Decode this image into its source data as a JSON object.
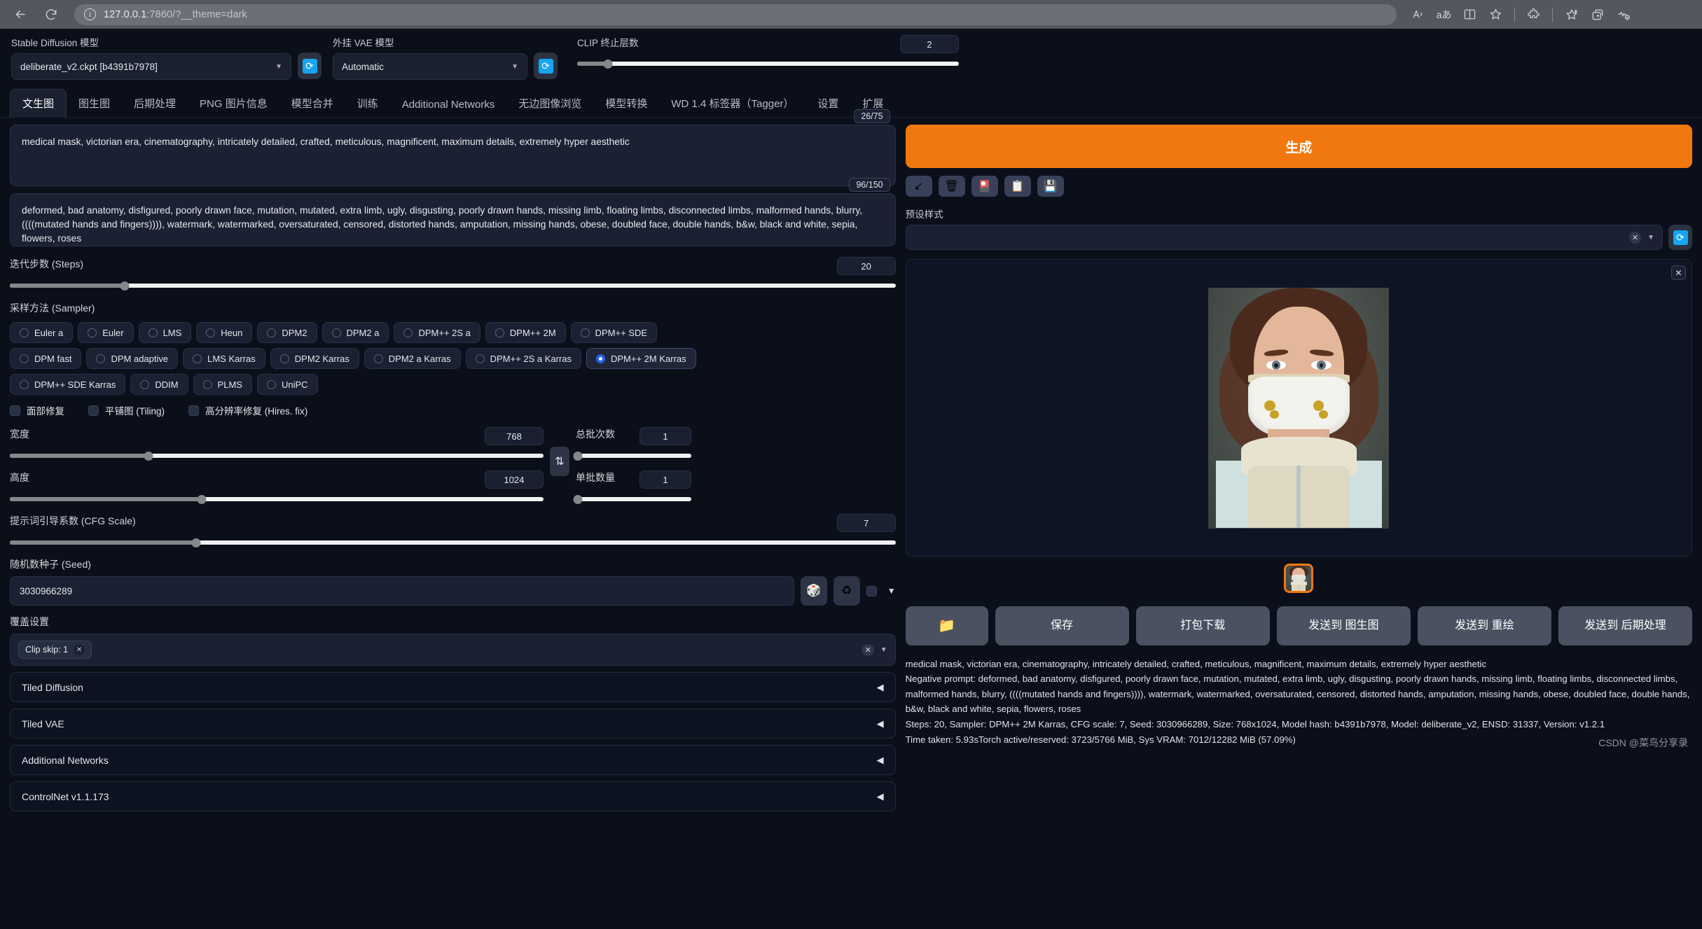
{
  "browser": {
    "back_icon": "back-arrow-icon",
    "reload_icon": "reload-icon",
    "url_host": "127.0.0.1",
    "url_rest": ":7860/?__theme=dark",
    "icons": [
      "read-aloud-icon",
      "translate-icon",
      "split-screen-icon",
      "favorite-star-icon",
      "extensions-icon",
      "collections-icon",
      "add-to-favorites-icon",
      "browser-essentials-icon"
    ]
  },
  "topbar": {
    "sd_model_label": "Stable Diffusion 模型",
    "sd_model_value": "deliberate_v2.ckpt [b4391b7978]",
    "vae_label": "外挂 VAE 模型",
    "vae_value": "Automatic",
    "clip_label": "CLIP 终止层数",
    "clip_value": "2",
    "clip_percent": 8,
    "refresh_icon": "refresh-icon"
  },
  "tabs": [
    {
      "label": "文生图",
      "active": true
    },
    {
      "label": "图生图",
      "active": false
    },
    {
      "label": "后期处理",
      "active": false
    },
    {
      "label": "PNG 图片信息",
      "active": false
    },
    {
      "label": "模型合并",
      "active": false
    },
    {
      "label": "训练",
      "active": false
    },
    {
      "label": "Additional Networks",
      "active": false
    },
    {
      "label": "无边图像浏览",
      "active": false
    },
    {
      "label": "模型转换",
      "active": false
    },
    {
      "label": "WD 1.4 标签器（Tagger）",
      "active": false
    },
    {
      "label": "设置",
      "active": false
    },
    {
      "label": "扩展",
      "active": false
    }
  ],
  "prompts": {
    "positive": "medical mask, victorian era, cinematography, intricately detailed, crafted, meticulous, magnificent, maximum details, extremely hyper aesthetic",
    "positive_counter": "26/75",
    "negative": "deformed, bad anatomy, disfigured, poorly drawn face, mutation, mutated, extra limb, ugly, disgusting, poorly drawn hands, missing limb, floating limbs, disconnected limbs, malformed hands, blurry, ((((mutated hands and fingers)))), watermark, watermarked, oversaturated, censored, distorted hands, amputation, missing hands, obese, doubled face, double hands, b&w, black and white, sepia, flowers, roses",
    "negative_counter": "96/150"
  },
  "generate": {
    "button_label": "生成",
    "accent_color": "#f0780f",
    "tools": [
      {
        "name": "arrow-down-left-icon",
        "glyph": "↙"
      },
      {
        "name": "trash-icon",
        "glyph": "🗑"
      },
      {
        "name": "palette-icon",
        "glyph": "🎴"
      },
      {
        "name": "clipboard-icon",
        "glyph": "📋"
      },
      {
        "name": "save-style-icon",
        "glyph": "💾"
      }
    ],
    "styles_label": "预设样式",
    "styles_value": "",
    "styles_clear_icon": "clear-x-icon",
    "styles_refresh_icon": "refresh-icon"
  },
  "settings": {
    "steps_label": "迭代步数 (Steps)",
    "steps_value": "20",
    "steps_percent": 13,
    "sampler_label": "采样方法 (Sampler)",
    "samplers": [
      [
        "Euler a",
        "Euler",
        "LMS",
        "Heun",
        "DPM2",
        "DPM2 a",
        "DPM++ 2S a",
        "DPM++ 2M",
        "DPM++ SDE"
      ],
      [
        "DPM fast",
        "DPM adaptive",
        "LMS Karras",
        "DPM2 Karras",
        "DPM2 a Karras",
        "DPM++ 2S a Karras",
        "DPM++ 2M Karras"
      ],
      [
        "DPM++ SDE Karras",
        "DDIM",
        "PLMS",
        "UniPC"
      ]
    ],
    "sampler_selected": "DPM++ 2M Karras",
    "checkboxes": [
      {
        "label": "面部修复",
        "checked": false
      },
      {
        "label": "平铺图 (Tiling)",
        "checked": false
      },
      {
        "label": "高分辨率修复 (Hires. fix)",
        "checked": false
      }
    ],
    "width_label": "宽度",
    "width_value": "768",
    "width_percent": 26,
    "height_label": "高度",
    "height_value": "1024",
    "height_percent": 36,
    "swap_icon": "swap-vertical-icon",
    "batch_count_label": "总批次数",
    "batch_count_value": "1",
    "batch_count_percent": 0,
    "batch_size_label": "单批数量",
    "batch_size_value": "1",
    "batch_size_percent": 0,
    "cfg_label": "提示词引导系数 (CFG Scale)",
    "cfg_value": "7",
    "cfg_percent": 21,
    "seed_label": "随机数种子 (Seed)",
    "seed_value": "3030966289",
    "seed_dice_icon": "dice-icon",
    "seed_recycle_icon": "recycle-icon",
    "override_label": "覆盖设置",
    "override_token": "Clip skip: 1",
    "override_clear_icon": "clear-x-icon"
  },
  "accordions": [
    {
      "label": "Tiled Diffusion",
      "arrow": "◀"
    },
    {
      "label": "Tiled VAE",
      "arrow": "◀"
    },
    {
      "label": "Additional Networks",
      "arrow": "◀"
    },
    {
      "label": "ControlNet v1.1.173",
      "arrow": "◀"
    }
  ],
  "output": {
    "close_icon": "close-icon",
    "folder_button_icon": "folder-icon",
    "buttons": [
      "保存",
      "打包下载",
      "发送到 图生图",
      "发送到 重绘",
      "发送到 后期处理"
    ],
    "info_line1": "medical mask, victorian era, cinematography, intricately detailed, crafted, meticulous, magnificent, maximum details, extremely hyper aesthetic",
    "info_line2": "Negative prompt: deformed, bad anatomy, disfigured, poorly drawn face, mutation, mutated, extra limb, ugly, disgusting, poorly drawn hands, missing limb, floating limbs, disconnected limbs, malformed hands, blurry, ((((mutated hands and fingers)))), watermark, watermarked, oversaturated, censored, distorted hands, amputation, missing hands, obese, doubled face, double hands, b&w, black and white, sepia, flowers, roses",
    "info_line3": "Steps: 20, Sampler: DPM++ 2M Karras, CFG scale: 7, Seed: 3030966289, Size: 768x1024, Model hash: b4391b7978, Model: deliberate_v2, ENSD: 31337, Version: v1.2.1",
    "time_taken": "Time taken: 5.93sTorch active/reserved: 3723/5766 MiB, Sys VRAM: 7012/12282 MiB (57.09%)",
    "watermark": "CSDN @菜鸟分享录"
  }
}
